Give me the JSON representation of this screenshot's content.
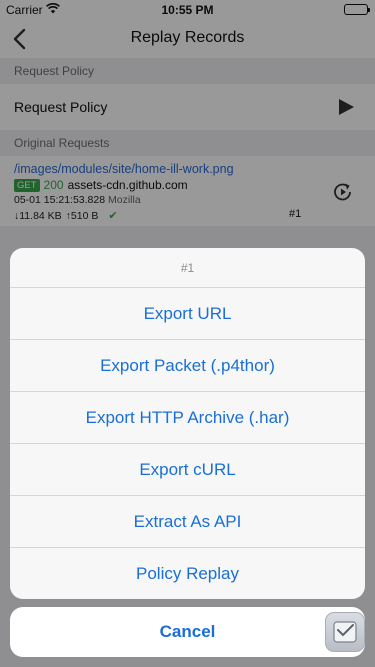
{
  "status_bar": {
    "carrier": "Carrier",
    "time": "10:55 PM"
  },
  "nav": {
    "title": "Replay Records",
    "back_icon": "chevron-left-icon"
  },
  "request_policy_section": {
    "header": "Request Policy",
    "cell_label": "Request Policy",
    "play_icon": "play-icon"
  },
  "original_requests_section": {
    "header": "Original Requests",
    "request": {
      "path": "/images/modules/site/home-ill-work.png",
      "method": "GET",
      "status_code": "200",
      "host": "assets-cdn.github.com",
      "timestamp": "05-01 15:21:53.828",
      "agent": "Mozilla",
      "download_size": "↓11.84 KB",
      "upload_size": "↑510 B",
      "check_icon": "checkmark-icon",
      "replay_icon": "replay-icon",
      "index": "#1"
    }
  },
  "action_sheet": {
    "title": "#1",
    "actions": [
      "Export URL",
      "Export Packet (.p4thor)",
      "Export HTTP Archive (.har)",
      "Export cURL",
      "Extract As API",
      "Policy Replay"
    ],
    "cancel_label": "Cancel"
  },
  "colors": {
    "accent": "#1a6fd6",
    "success": "#37a54c",
    "group_background": "#efeff4"
  }
}
